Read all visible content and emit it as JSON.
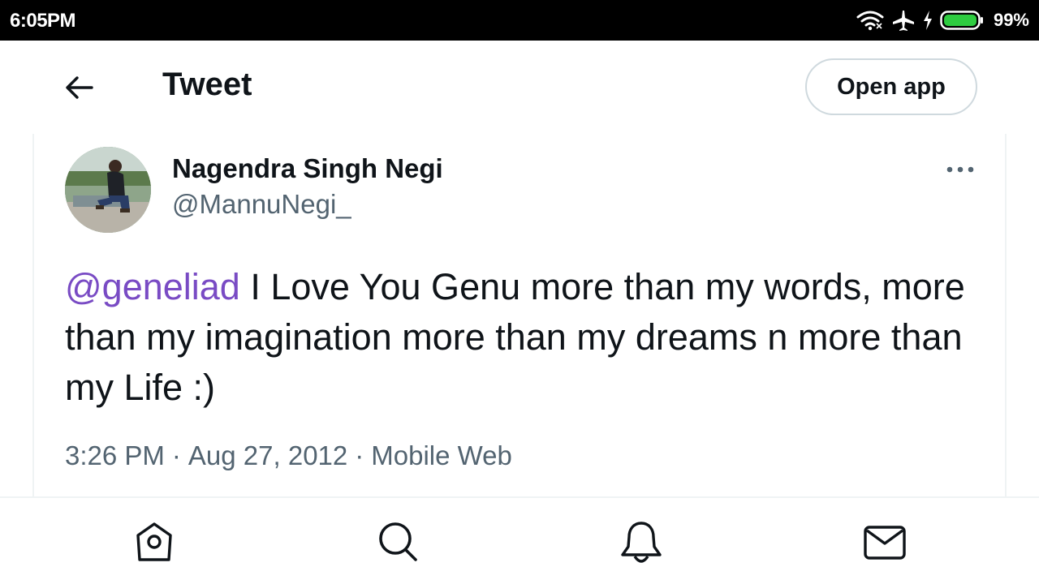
{
  "status_bar": {
    "time": "6:05PM",
    "battery_percent": "99%",
    "icons": [
      "wifi-icon",
      "airplane-icon",
      "charging-icon",
      "battery-icon"
    ]
  },
  "header": {
    "back_icon": "arrow-left-icon",
    "title": "Tweet",
    "open_app_label": "Open app"
  },
  "tweet": {
    "author_name": "Nagendra Singh Negi",
    "author_handle": "@MannuNegi_",
    "more_icon": "more-horizontal-icon",
    "mention": "@geneliad",
    "text": " I Love You Genu more than my words, more than my imagination more than my dreams n more than my Life :)",
    "time": "3:26 PM",
    "date": "Aug 27, 2012",
    "source": "Mobile Web",
    "separator": "·"
  },
  "bottom_nav": {
    "items": [
      "home-icon",
      "search-icon",
      "notifications-icon",
      "messages-icon"
    ]
  },
  "colors": {
    "text_primary": "#0f1419",
    "text_secondary": "#536471",
    "mention": "#794bc4",
    "border": "#cfd9de",
    "status_bar_bg": "#000000",
    "battery_green": "#2ecc40"
  }
}
